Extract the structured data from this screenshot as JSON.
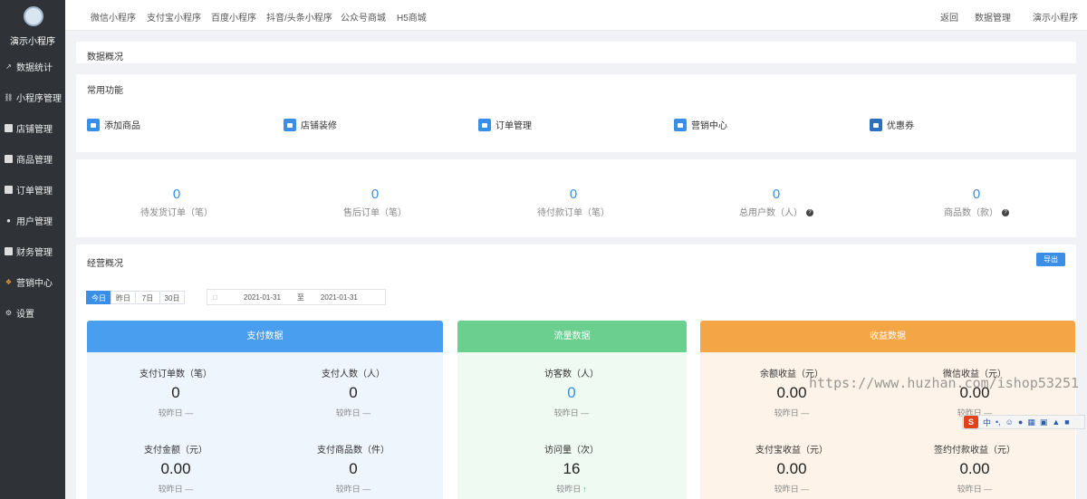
{
  "sidebar": {
    "app_name": "演示小程序",
    "items": [
      {
        "label": "数据统计",
        "icon": "chart-icon"
      },
      {
        "label": "小程序管理",
        "icon": "link-icon"
      },
      {
        "label": "店铺管理",
        "icon": "shop-icon"
      },
      {
        "label": "商品管理",
        "icon": "goods-icon"
      },
      {
        "label": "订单管理",
        "icon": "order-icon"
      },
      {
        "label": "用户管理",
        "icon": "user-icon"
      },
      {
        "label": "财务管理",
        "icon": "finance-icon"
      },
      {
        "label": "营销中心",
        "icon": "marketing-icon"
      },
      {
        "label": "设置",
        "icon": "settings-icon"
      }
    ]
  },
  "topbar": {
    "tabs": [
      "微信小程序",
      "支付宝小程序",
      "百度小程序",
      "抖音/头条小程序",
      "公众号商城",
      "H5商城"
    ],
    "right": [
      "返回",
      "数据管理",
      "演示小程序"
    ]
  },
  "overview": {
    "title": "数据概况"
  },
  "common": {
    "title": "常用功能",
    "items": [
      "添加商品",
      "店铺装修",
      "订单管理",
      "营销中心",
      "优惠券"
    ]
  },
  "stats": [
    {
      "value": "0",
      "label": "待发货订单（笔）",
      "help": false
    },
    {
      "value": "0",
      "label": "售后订单（笔）",
      "help": false
    },
    {
      "value": "0",
      "label": "待付款订单（笔）",
      "help": false
    },
    {
      "value": "0",
      "label": "总用户数（人）",
      "help": true
    },
    {
      "value": "0",
      "label": "商品数（款）",
      "help": true
    }
  ],
  "business": {
    "title": "经营概况",
    "export_label": "导出",
    "range_tabs": [
      "今日",
      "昨日",
      "7日",
      "30日"
    ],
    "active_range": "今日",
    "date_start": "2021-01-31",
    "date_sep": "至",
    "date_end": "2021-01-31"
  },
  "cards": [
    {
      "title": "支付数据",
      "color": "#4a9ef0",
      "body_bg": "#eef5fd",
      "cells": [
        {
          "label": "支付订单数（笔）",
          "value": "0",
          "compare": "较昨日 —"
        },
        {
          "label": "支付人数（人）",
          "value": "0",
          "compare": "较昨日 —"
        },
        {
          "label": "支付金额（元）",
          "value": "0.00",
          "compare": "较昨日 —"
        },
        {
          "label": "支付商品数（件）",
          "value": "0",
          "compare": "较昨日 —"
        }
      ]
    },
    {
      "title": "流量数据",
      "color": "#6bcf8f",
      "body_bg": "#eefaf2",
      "cells": [
        {
          "label": "访客数（人）",
          "value": "0",
          "compare": "较昨日 —"
        },
        {
          "label": "访问量（次）",
          "value": "16",
          "compare": "较昨日"
        }
      ]
    },
    {
      "title": "收益数据",
      "color": "#f4a545",
      "body_bg": "#fdf3e8",
      "cells": [
        {
          "label": "余额收益（元）",
          "value": "0.00",
          "compare": "较昨日 —"
        },
        {
          "label": "微信收益（元）",
          "value": "0.00",
          "compare": "较昨日 —"
        },
        {
          "label": "支付宝收益（元）",
          "value": "0.00",
          "compare": "较昨日 —"
        },
        {
          "label": "签约付款收益（元）",
          "value": "0.00",
          "compare": "较昨日 —"
        }
      ]
    }
  ],
  "watermark": "https://www.huzhan.com/ishop53251",
  "ime_toolbar": {
    "logo": "S",
    "mode": "中"
  }
}
